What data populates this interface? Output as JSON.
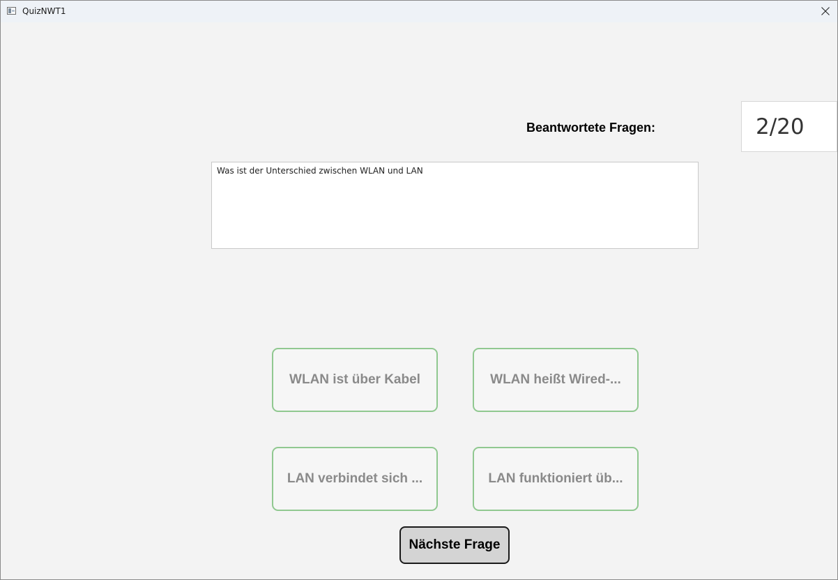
{
  "window": {
    "title": "QuizNWT1",
    "icon": "app-window-icon",
    "close_icon": "close-icon"
  },
  "progress": {
    "label": "Beantwortete Fragen:",
    "value": "2/20",
    "answered": 2,
    "total": 20
  },
  "question": {
    "text": "Was ist der Unterschied zwischen WLAN und LAN"
  },
  "answers": [
    {
      "label": "WLAN ist über Kabel"
    },
    {
      "label": "WLAN heißt Wired-..."
    },
    {
      "label": "LAN verbindet sich ..."
    },
    {
      "label": "LAN funktioniert üb..."
    }
  ],
  "next_button": {
    "label": "Nächste Frage"
  },
  "colors": {
    "answer_border": "#90c890",
    "answer_text": "#8a8a8a",
    "next_bg": "#d4d4d4"
  }
}
